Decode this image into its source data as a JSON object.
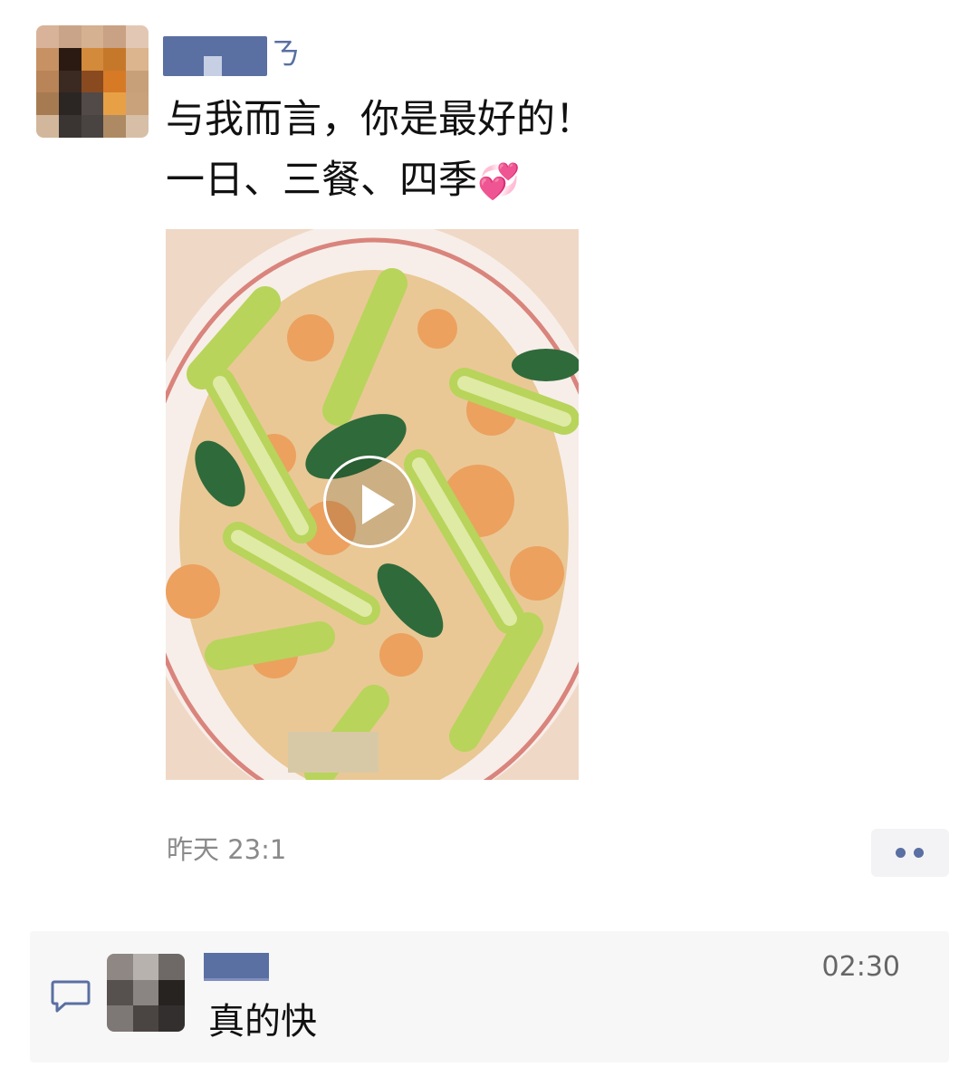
{
  "post": {
    "line1": "与我而言，你是最好的！",
    "line2": "一日、三餐、四季",
    "emoji": "💞",
    "timestamp": "昨天 23:1"
  },
  "icons": {
    "play": "play-icon",
    "more": "more-dots-icon",
    "comment": "comment-bubble-icon"
  },
  "comment": {
    "time": "02:30",
    "text": "真的快"
  }
}
